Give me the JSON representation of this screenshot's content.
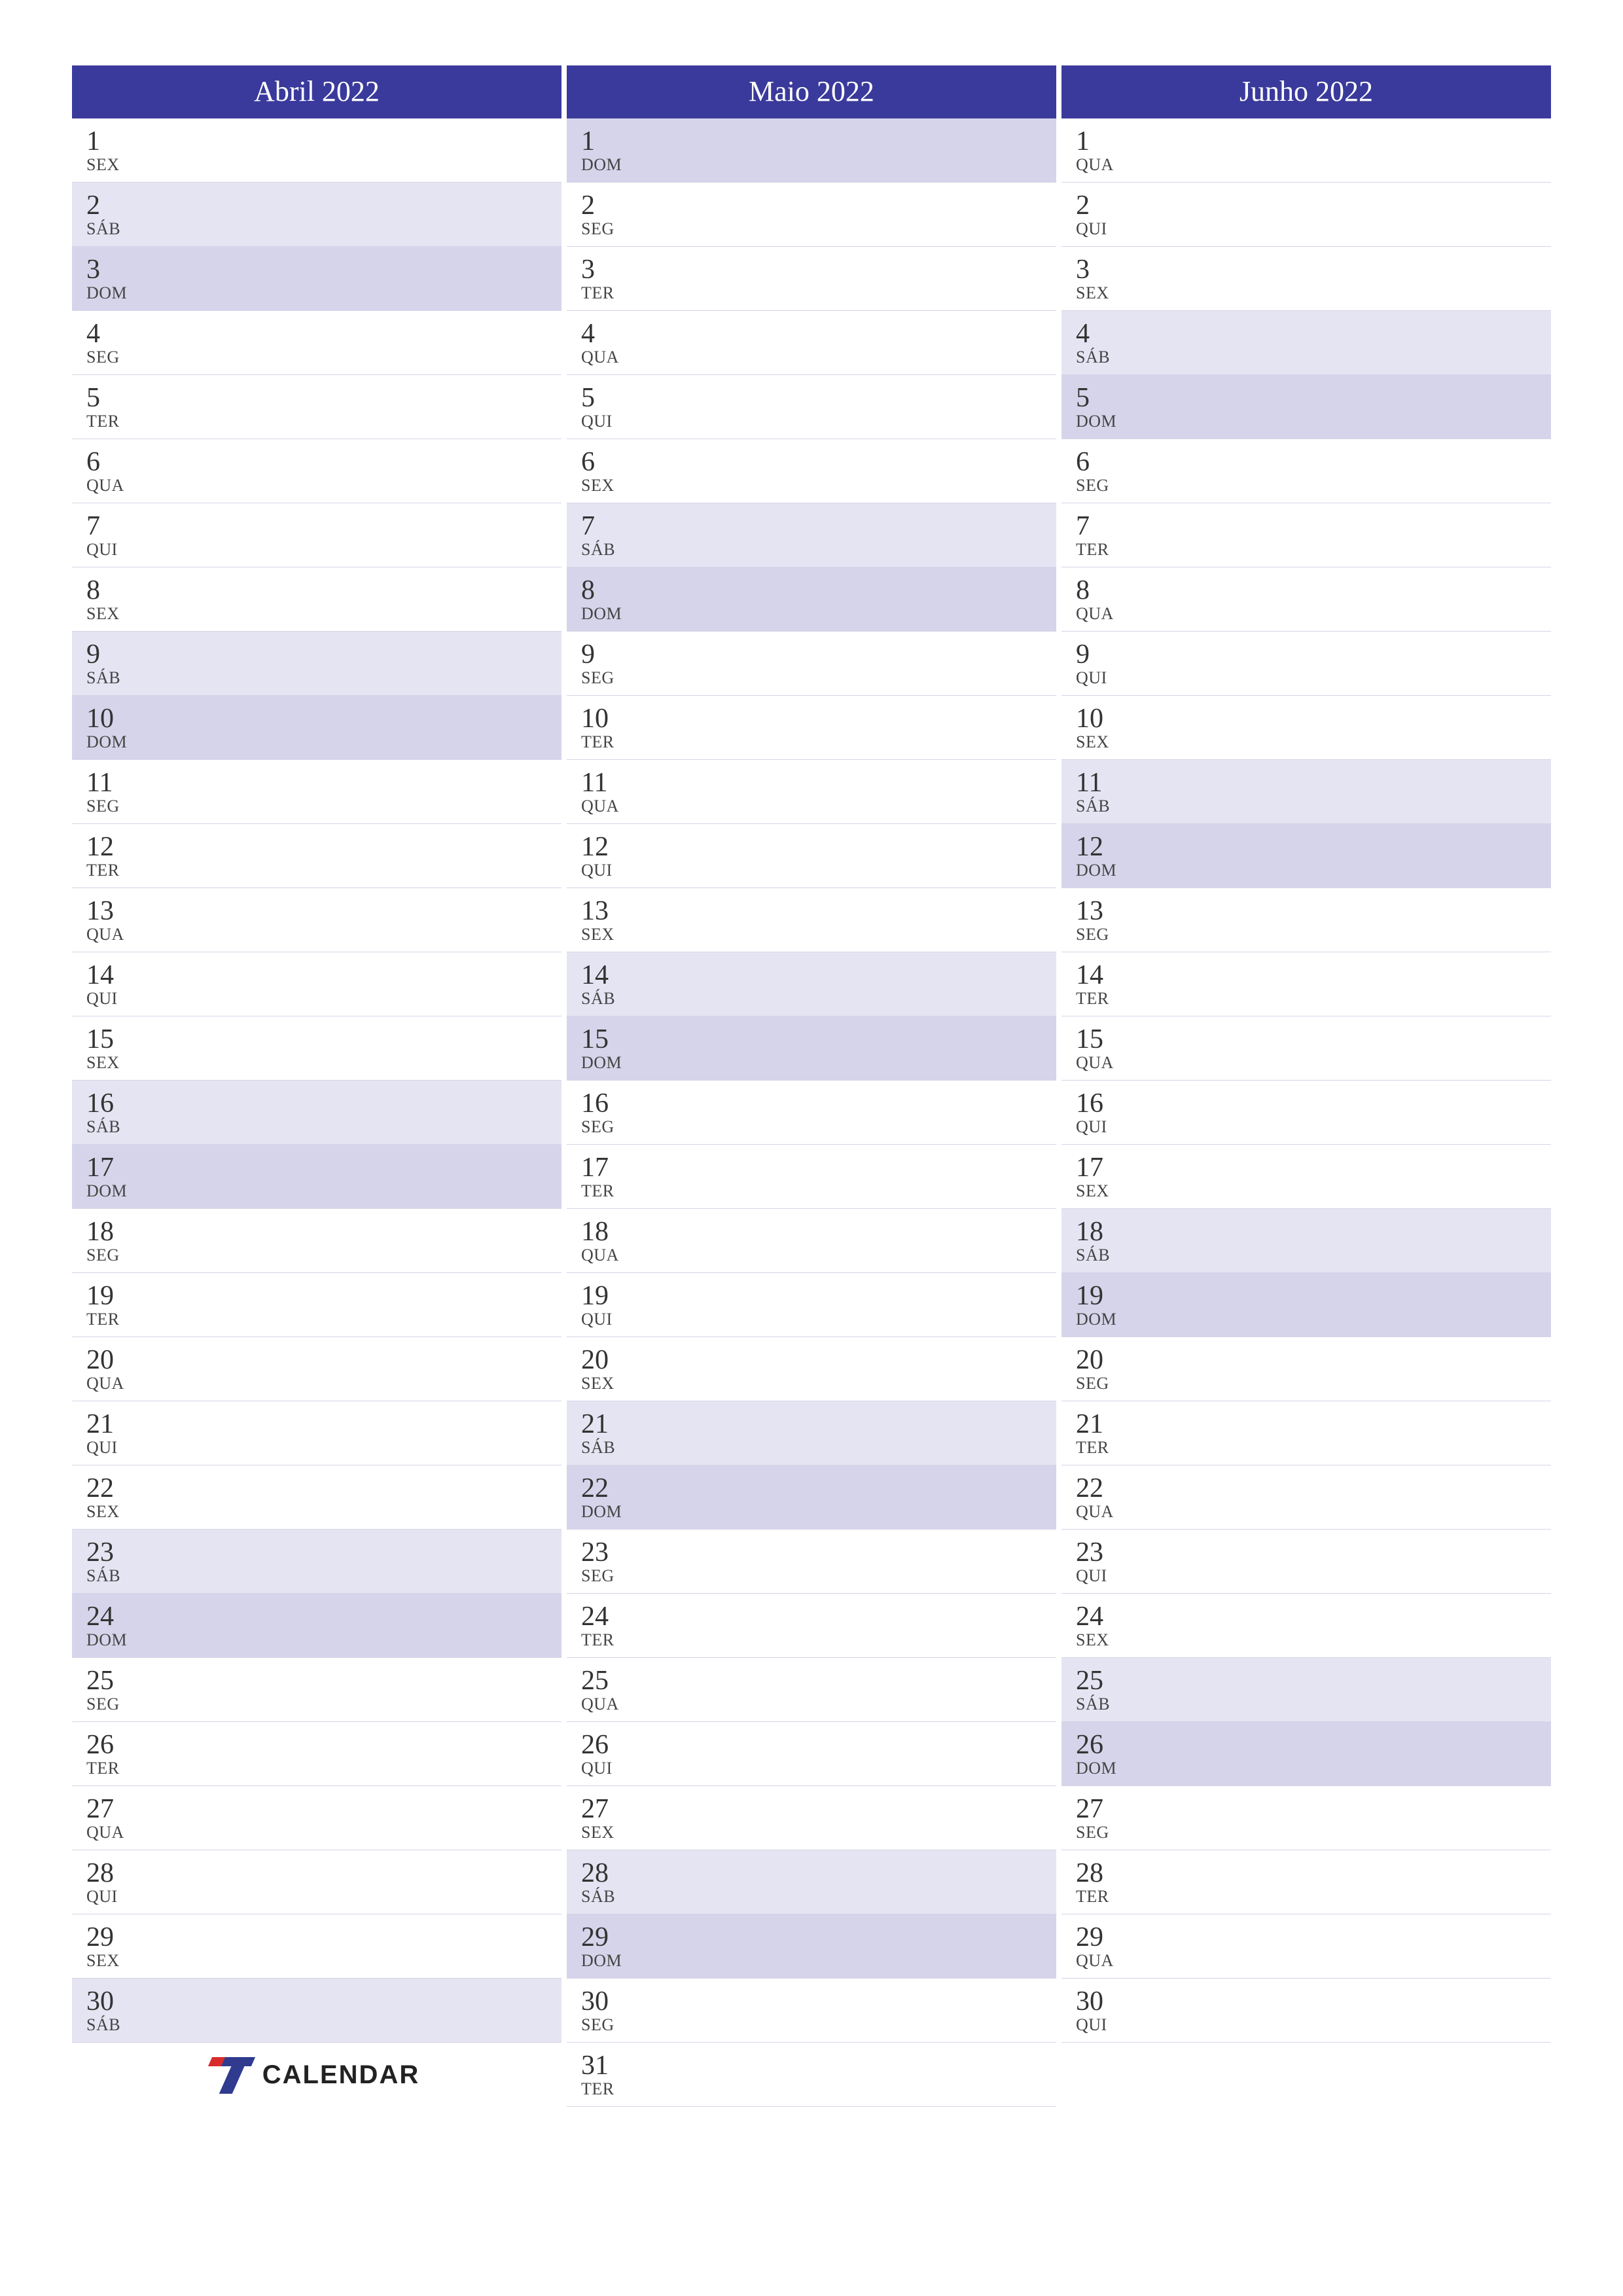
{
  "logo_text": "CALENDAR",
  "day_abbrev": {
    "mon": "SEG",
    "tue": "TER",
    "wed": "QUA",
    "thu": "QUI",
    "fri": "SEX",
    "sat": "SÁB",
    "sun": "DOM"
  },
  "months": [
    {
      "title": "Abril 2022",
      "num_days": 30,
      "first_weekday": "fri",
      "show_logo_after": true
    },
    {
      "title": "Maio 2022",
      "num_days": 31,
      "first_weekday": "sun",
      "show_logo_after": false
    },
    {
      "title": "Junho 2022",
      "num_days": 30,
      "first_weekday": "wed",
      "show_logo_after": false
    }
  ]
}
